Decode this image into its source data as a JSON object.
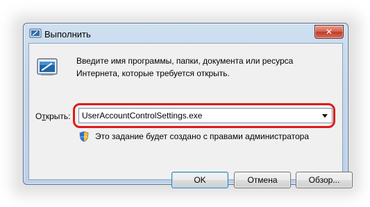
{
  "window": {
    "title": "Выполнить",
    "close_symbol": "✕"
  },
  "dialog": {
    "description": "Введите имя программы, папки, документа или ресурса Интернета, которые требуется открыть.",
    "open_label_prefix": "О",
    "open_label_underlined": "т",
    "open_label_rest": "крыть:",
    "command_value": "UserAccountControlSettings.exe",
    "admin_note": "Это задание будет создано с правами администратора"
  },
  "buttons": {
    "ok": "OK",
    "cancel": "Отмена",
    "browse": "Обзор..."
  },
  "icons": {
    "title": "run-icon",
    "run": "run-program-icon",
    "shield": "uac-shield-icon",
    "dropdown": "chevron-down-icon"
  },
  "colors": {
    "highlight": "#e01919",
    "titlebar": "#c3d6ec",
    "close_button": "#c13a26"
  }
}
